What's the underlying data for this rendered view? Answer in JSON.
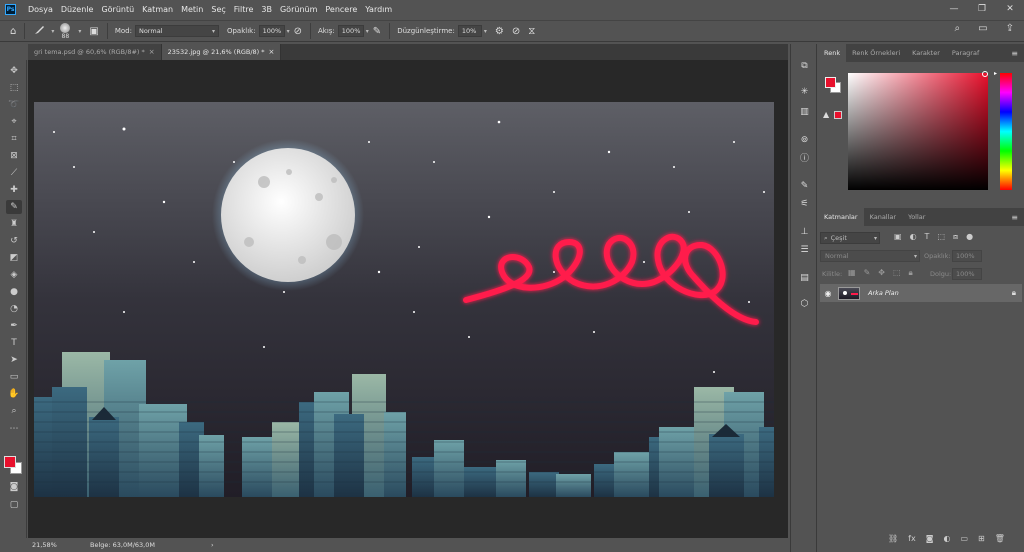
{
  "app": {
    "logo": "Ps"
  },
  "menu": [
    "Dosya",
    "Düzenle",
    "Görüntü",
    "Katman",
    "Metin",
    "Seç",
    "Filtre",
    "3B",
    "Görünüm",
    "Pencere",
    "Yardım"
  ],
  "window_controls": {
    "minimize": "—",
    "maximize": "❐",
    "close": "✕"
  },
  "options": {
    "brush_size": "88",
    "mode_label": "Mod:",
    "mode_value": "Normal",
    "opacity_label": "Opaklık:",
    "opacity_value": "100%",
    "flow_label": "Akış:",
    "flow_value": "100%",
    "smoothing_label": "Düzgünleştirme:",
    "smoothing_value": "10%"
  },
  "tabs": [
    {
      "label": "gri tema.psd @ 60,6% (RGB/8#) *",
      "close": "×",
      "active": false
    },
    {
      "label": "23532.jpg @ 21,6% (RGB/8) *",
      "close": "×",
      "active": true
    }
  ],
  "status": {
    "zoom": "21,58%",
    "doc_info": "Belge: 63,0M/63,0M",
    "arrow": "›"
  },
  "color_panel": {
    "tabs": [
      "Renk",
      "Renk Örnekleri",
      "Karakter",
      "Paragraf"
    ],
    "foreground": "#e8102c",
    "background": "#ffffff"
  },
  "layers_panel": {
    "tabs": [
      "Katmanlar",
      "Kanallar",
      "Yollar"
    ],
    "filter_label": "Çeşit",
    "blend_mode": "Normal",
    "opacity_label": "Opaklık:",
    "opacity_value": "100%",
    "lock_label": "Kilitle:",
    "fill_label": "Dolgu:",
    "fill_value": "100%",
    "layers": [
      {
        "name": "Arka Plan",
        "visible": true,
        "locked": true
      }
    ]
  },
  "colors": {
    "accent_red": "#ff1a4b",
    "panel_bg": "#535353",
    "canvas_bg": "#282828"
  }
}
